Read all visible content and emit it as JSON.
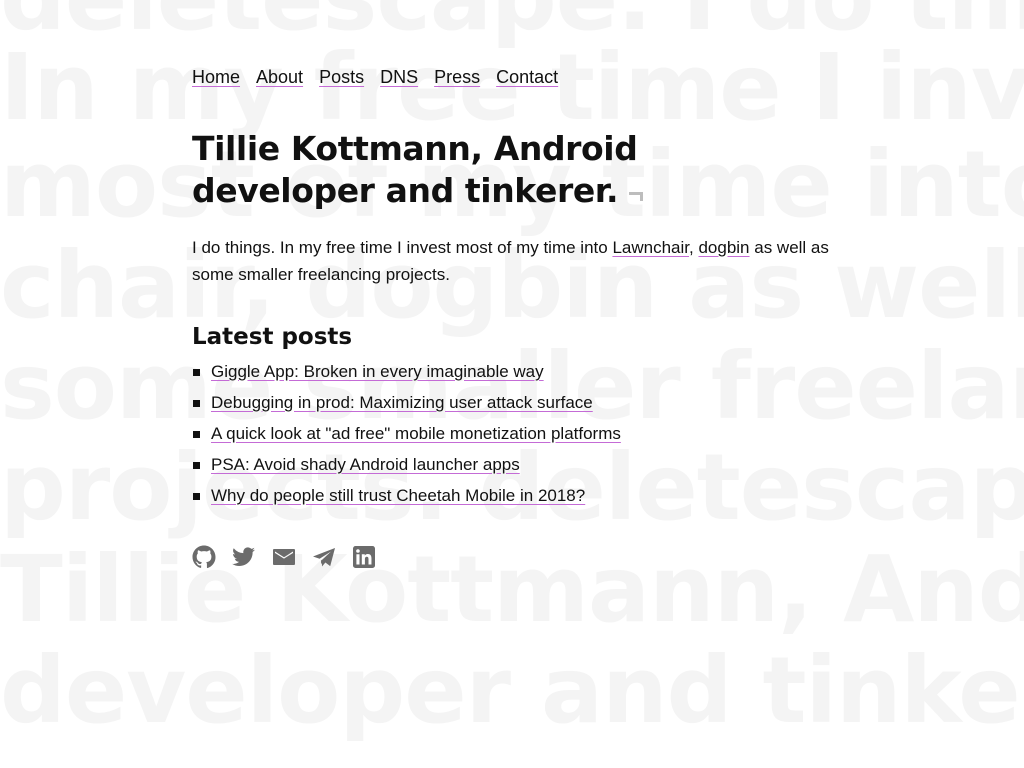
{
  "background": {
    "lines": [
      "deletescape. I do things.",
      "In my free time I invest",
      "most of my time into lawn",
      "chair, dogbin as well as",
      "some smaller freelancin",
      "projects. deletescap",
      "Tillie Kottmann, Andro",
      "developer and tinkere"
    ]
  },
  "nav": {
    "items": [
      "Home",
      "About",
      "Posts",
      "DNS",
      "Press",
      "Contact"
    ]
  },
  "header": {
    "title": "Tillie Kottmann, Android developer and tinkerer."
  },
  "intro": {
    "prefix": "I do things. In my free time I invest most of my time into ",
    "link1": "Lawnchair",
    "sep": ", ",
    "link2": "dogbin",
    "suffix": " as well as some smaller freelancing projects."
  },
  "latest": {
    "heading": "Latest posts",
    "posts": [
      "Giggle App: Broken in every imaginable way",
      "Debugging in prod: Maximizing user attack surface",
      "A quick look at \"ad free\" mobile monetization platforms",
      "PSA: Avoid shady Android launcher apps",
      "Why do people still trust Cheetah Mobile in 2018?"
    ]
  },
  "social": {
    "icons": [
      "github-icon",
      "twitter-icon",
      "email-icon",
      "telegram-icon",
      "linkedin-icon"
    ],
    "color": "#6b6b6b"
  },
  "colors": {
    "link_underline": "#c46bd6",
    "background_text": "#f4f4f4"
  }
}
